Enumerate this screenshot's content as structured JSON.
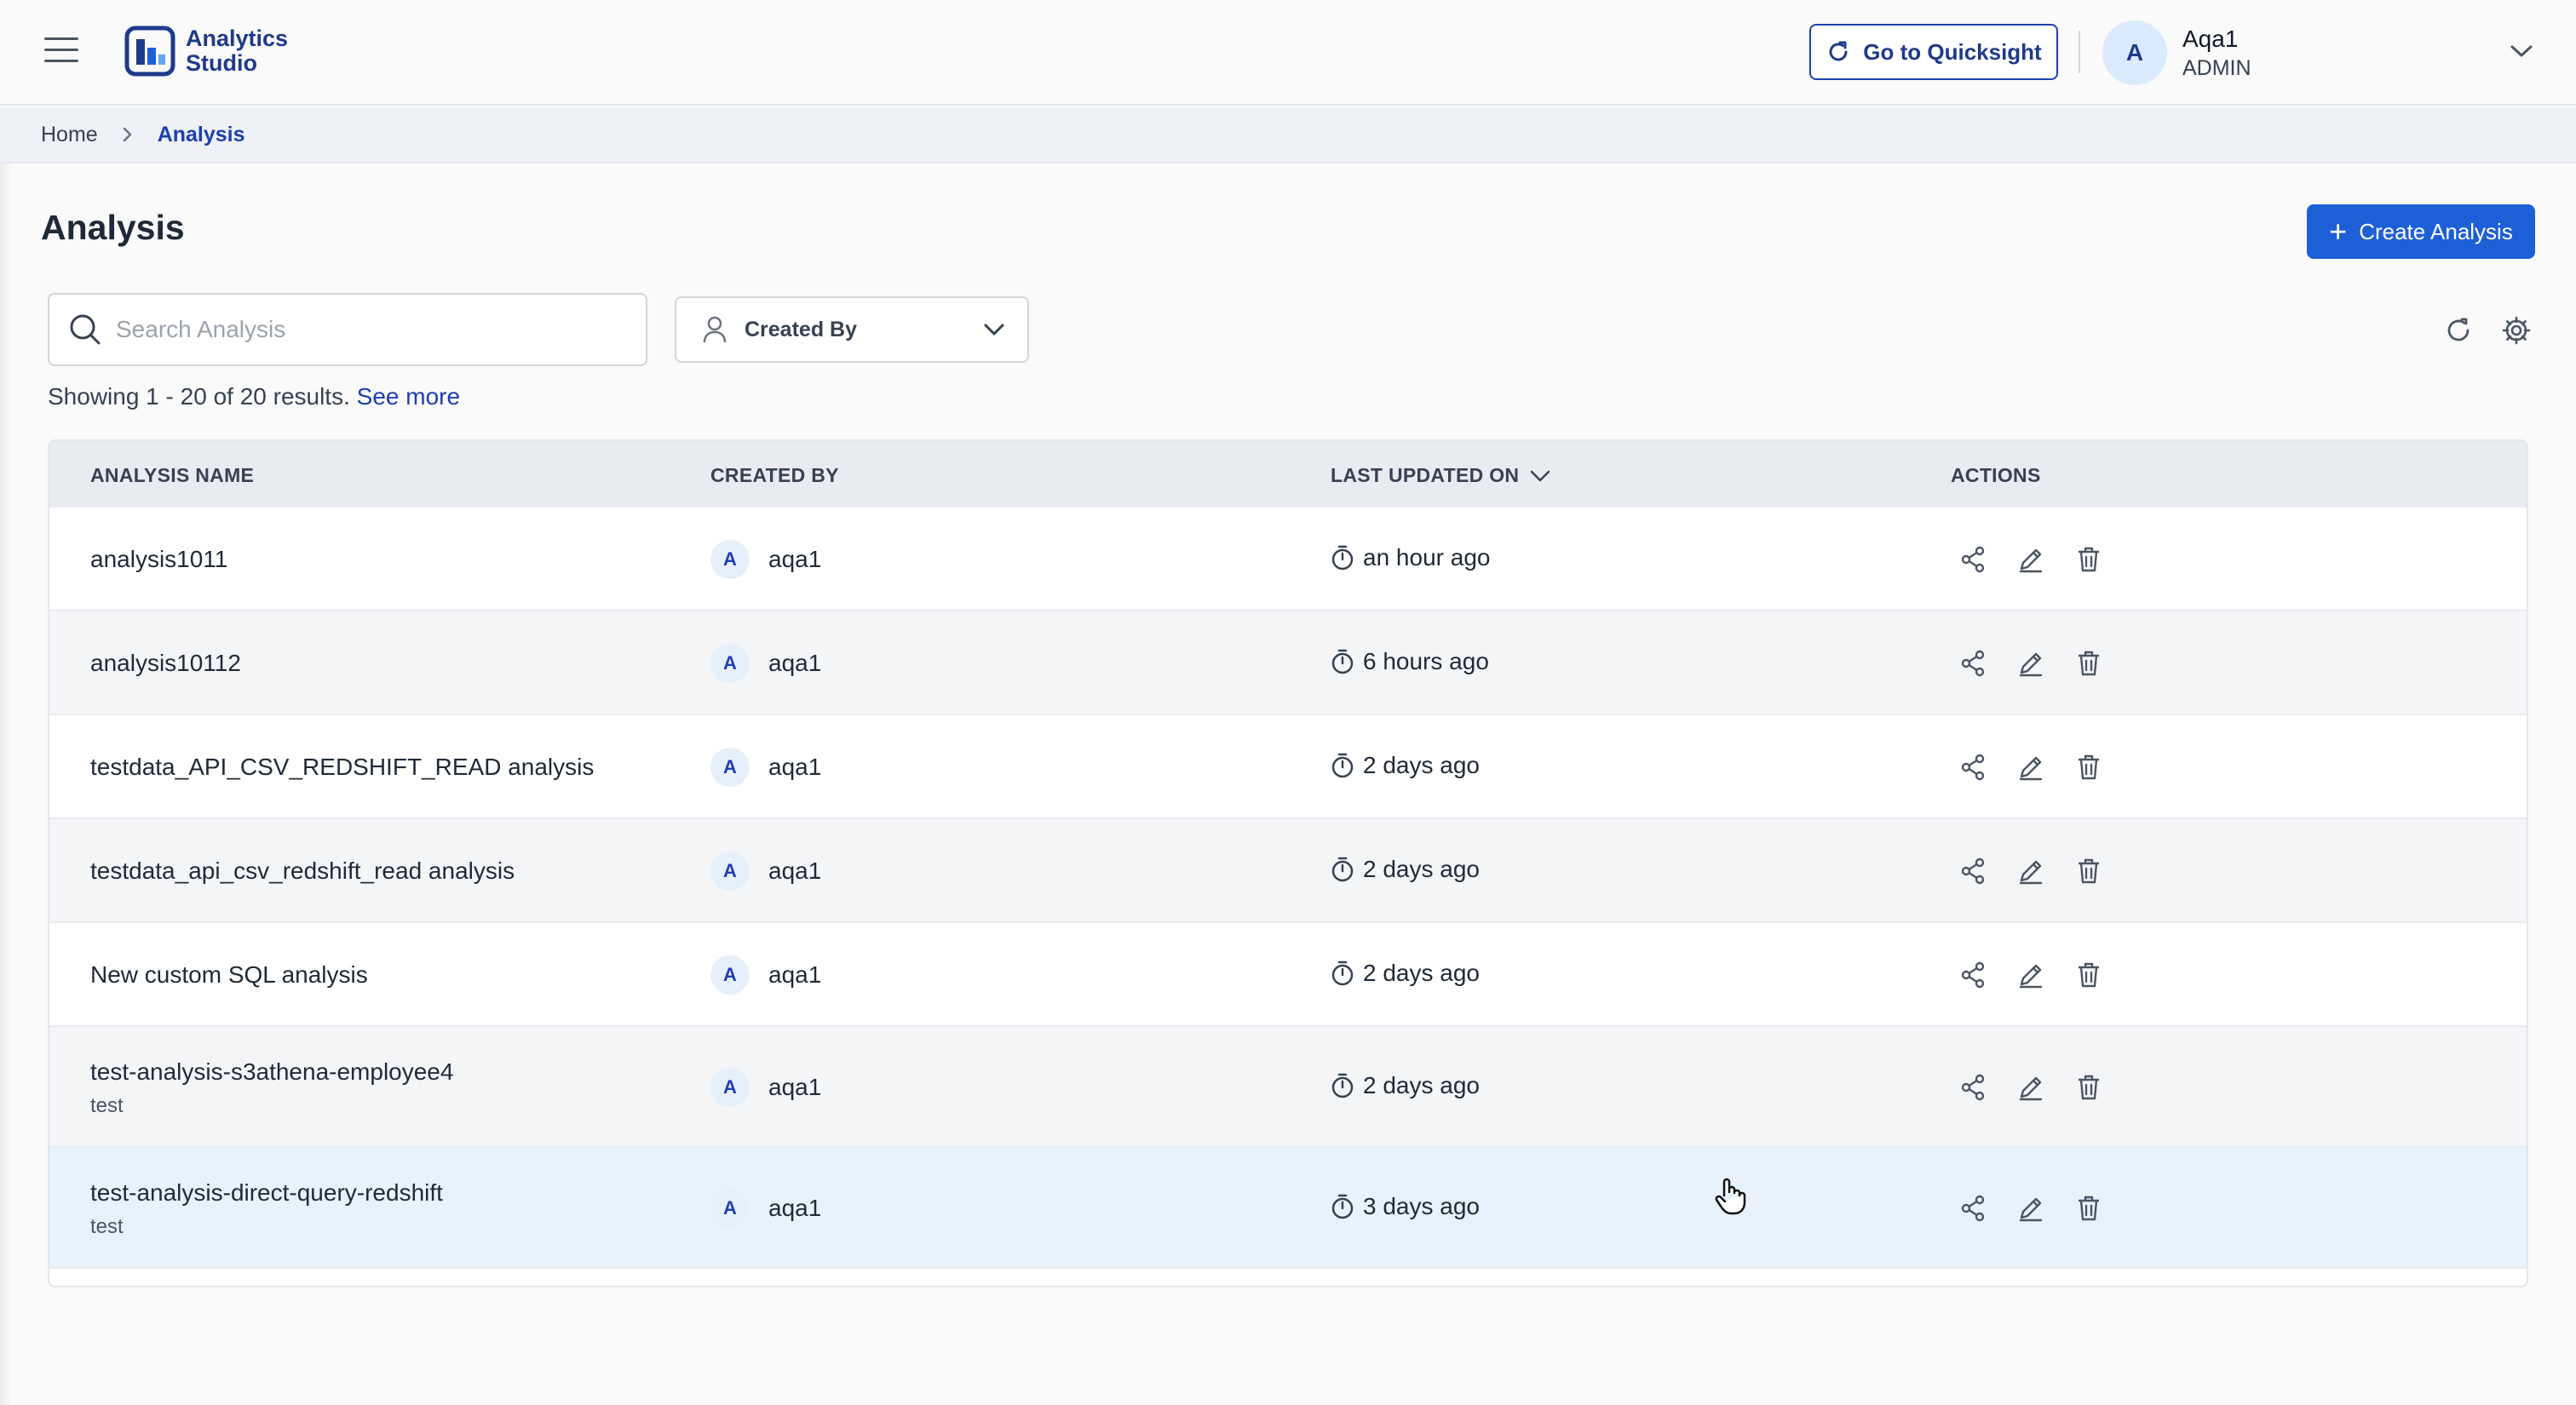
{
  "header": {
    "app_name_line1": "Analytics",
    "app_name_line2": "Studio",
    "quicksight_label": "Go to Quicksight",
    "user": {
      "initial": "A",
      "name": "Aqa1",
      "role": "ADMIN"
    }
  },
  "breadcrumb": {
    "home": "Home",
    "current": "Analysis"
  },
  "page": {
    "title": "Analysis",
    "create_label": "Create Analysis",
    "search_placeholder": "Search Analysis",
    "search_value": "",
    "filter_label": "Created By",
    "results_text": "Showing 1 - 20 of 20 results.",
    "see_more": "See more"
  },
  "table": {
    "columns": {
      "name": "ANALYSIS NAME",
      "created_by": "CREATED BY",
      "last_updated": "LAST UPDATED ON",
      "actions": "ACTIONS"
    },
    "rows": [
      {
        "name": "analysis1011",
        "description": "",
        "creator_initial": "A",
        "creator": "aqa1",
        "updated": "an hour ago"
      },
      {
        "name": "analysis10112",
        "description": "",
        "creator_initial": "A",
        "creator": "aqa1",
        "updated": "6 hours ago"
      },
      {
        "name": "testdata_API_CSV_REDSHIFT_READ analysis",
        "description": "",
        "creator_initial": "A",
        "creator": "aqa1",
        "updated": "2 days ago"
      },
      {
        "name": "testdata_api_csv_redshift_read analysis",
        "description": "",
        "creator_initial": "A",
        "creator": "aqa1",
        "updated": "2 days ago"
      },
      {
        "name": "New custom SQL analysis",
        "description": "",
        "creator_initial": "A",
        "creator": "aqa1",
        "updated": "2 days ago"
      },
      {
        "name": "test-analysis-s3athena-employee4",
        "description": "test",
        "creator_initial": "A",
        "creator": "aqa1",
        "updated": "2 days ago"
      },
      {
        "name": "test-analysis-direct-query-redshift",
        "description": "test",
        "creator_initial": "A",
        "creator": "aqa1",
        "updated": "3 days ago"
      }
    ]
  },
  "icons": {
    "menu": "hamburger-icon",
    "quicksight": "external-refresh-icon",
    "search": "search-icon",
    "user_filter": "user-icon",
    "refresh": "refresh-icon",
    "settings": "gear-icon",
    "clock": "timer-icon",
    "share": "share-icon",
    "edit": "pencil-icon",
    "delete": "trash-icon"
  },
  "colors": {
    "primary": "#1d5fd6",
    "brand_text": "#1e3a8a",
    "row_hover": "#e7f2fb",
    "header_bg": "#e8ebf0"
  }
}
